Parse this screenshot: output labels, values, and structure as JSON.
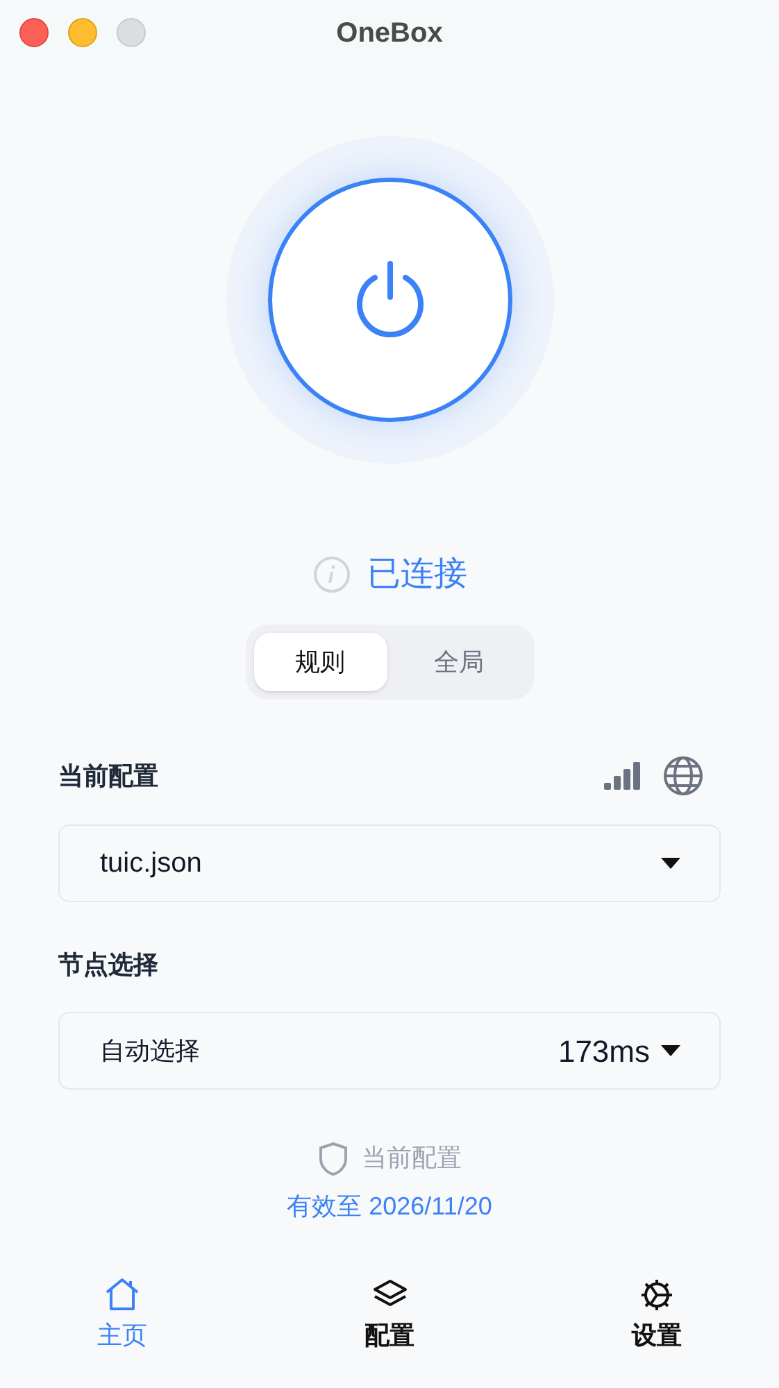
{
  "window": {
    "title": "OneBox"
  },
  "status": {
    "label": "已连接",
    "connected": true
  },
  "modes": [
    {
      "label": "规则",
      "selected": true
    },
    {
      "label": "全局",
      "selected": false
    }
  ],
  "config": {
    "label": "当前配置",
    "value": "tuic.json"
  },
  "node": {
    "label": "节点选择",
    "value": "自动选择",
    "latency": "173ms"
  },
  "subscription": {
    "label": "当前配置",
    "expiry": "有效至 2026/11/20"
  },
  "nav": [
    {
      "kind": "home",
      "label": "主页",
      "selected": true
    },
    {
      "kind": "layers",
      "label": "配置",
      "selected": false
    },
    {
      "kind": "gear",
      "label": "设置",
      "selected": false
    }
  ]
}
